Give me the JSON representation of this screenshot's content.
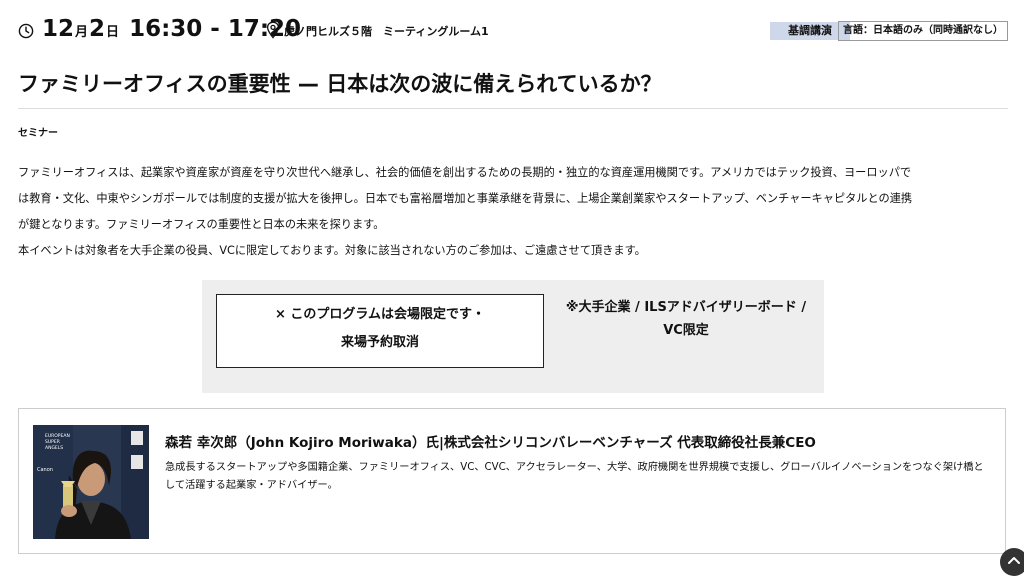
{
  "session": {
    "month": "12",
    "month_unit": "月",
    "day": "2",
    "day_unit": "日",
    "time_range": "16:30 - 17:20",
    "location": "虎ノ門ヒルズ５階　ミーティングルーム1",
    "badge_keynote": "基調講演",
    "badge_language": "言語：日本語のみ（同時通訳なし）"
  },
  "title": "ファミリーオフィスの重要性 — 日本は次の波に備えられているか？",
  "category": "セミナー",
  "description": [
    "ファミリーオフィスは、起業家や資産家が資産を守り次世代へ継承し、社会的価値を創出するための長期的・独立的な資産運用機関です。アメリカではテック投資、ヨーロッパで",
    "は教育・文化、中東やシンガポールでは制度的支援が拡大を後押し。日本でも富裕層増加と事業承継を背景に、上場企業創業家やスタートアップ、ベンチャーキャピタルとの連携",
    "が鍵となります。ファミリーオフィスの重要性と日本の未来を探ります。",
    "本イベントは対象者を大手企業の役員、VCに限定しております。対象に該当されない方のご参加は、ご遠慮させて頂きます。"
  ],
  "notice": {
    "closed_line1": "× このプログラムは会場限定です・",
    "closed_line2": "来場予約取消",
    "restriction": "※大手企業 / ILSアドバイザリーボード / VC限定"
  },
  "speaker": {
    "name": "森若 幸次郎（John Kojiro Moriwaka）氏|株式会社シリコンバレーベンチャーズ 代表取締役社長兼CEO",
    "bio": "急成長するスタートアップや多国籍企業、ファミリーオフィス、VC、CVC、アクセラレーター、大学、政府機関を世界規模で支援し、グローバルイノベーションをつなぐ架け橋として活躍する起業家・アドバイザー。",
    "photo_backdrop_text": [
      "EUROPEAN",
      "SUPER",
      "ANGELS",
      "Canon"
    ]
  },
  "icons": {
    "clock": "clock-icon",
    "location": "map-pin-icon",
    "scroll_top": "arrow-up-icon"
  },
  "colors": {
    "keynote_badge_bg": "#cfd8ea",
    "notice_bg": "#eeeeee",
    "text": "#111111"
  }
}
